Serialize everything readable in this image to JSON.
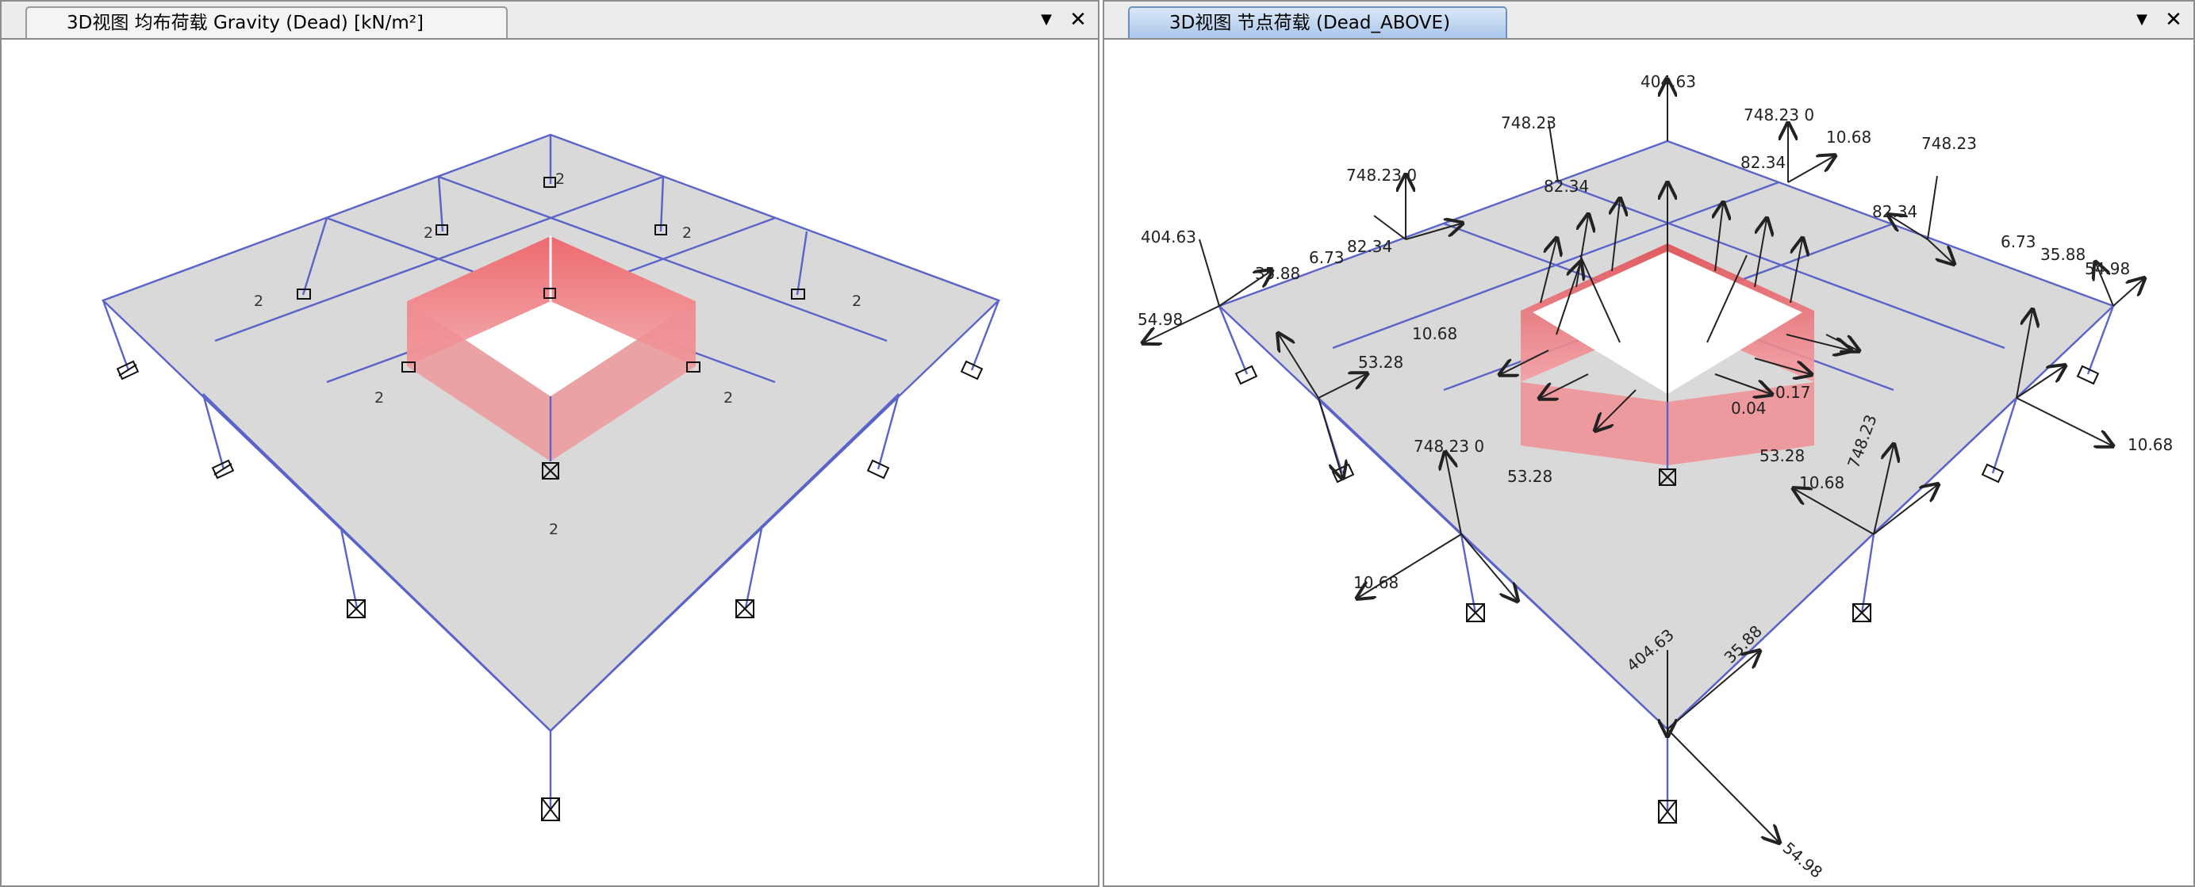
{
  "left_view": {
    "tab_title": "3D视图  均布荷载 Gravity  (Dead)  [kN/m²]",
    "menu_icon": "dropdown-arrow",
    "close_icon": "close-x",
    "load_marker": "2"
  },
  "right_view": {
    "tab_title": "3D视图  节点荷载 (Dead_ABOVE)",
    "menu_icon": "dropdown-arrow",
    "close_icon": "close-x",
    "load_values": {
      "v404": "404.63",
      "v748": "748.23",
      "v748z": "748.23  0",
      "v54": "54.98",
      "v35": "35.88",
      "v673": "6.73",
      "v8234": "82.34",
      "v1068": "10.68",
      "v5328": "53.28",
      "v1068b": "10.68",
      "v8234b": "82.34",
      "v748b": "748.23",
      "v5498b": "54.98",
      "v40463b": "404.63",
      "v3588b": "35.88",
      "v7482": "748.23",
      "v01": "0.17",
      "v004": "0.04"
    }
  },
  "colors": {
    "plate": "#d9d9d9",
    "edge": "#5b63c8",
    "wall": "#e8575c",
    "tab_active": "#a9c6ea"
  }
}
